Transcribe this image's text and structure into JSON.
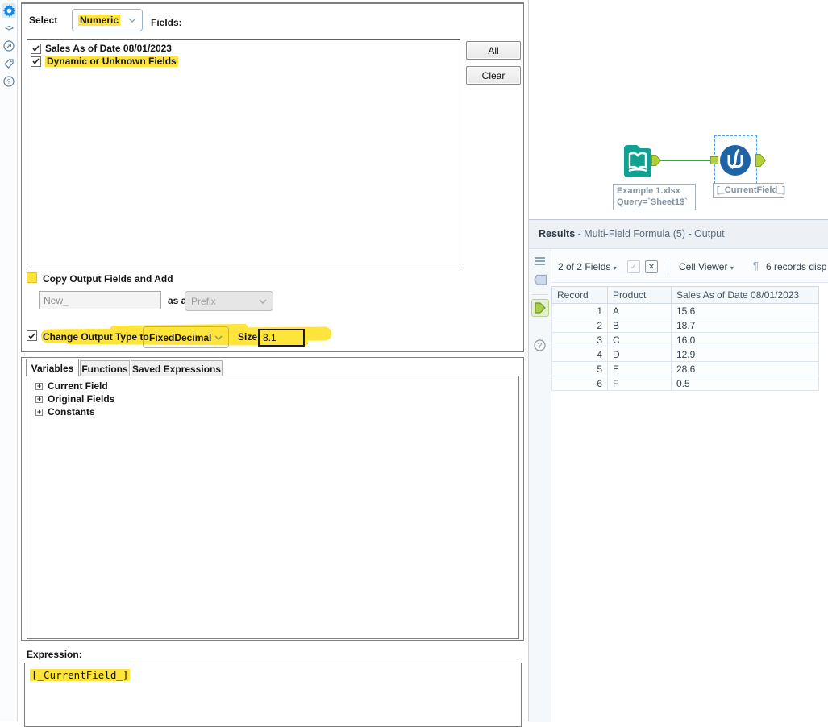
{
  "app_sidebar": {
    "icons": [
      {
        "name": "configuration-gear",
        "selected": true
      },
      {
        "name": "code",
        "selected": false
      },
      {
        "name": "open-external",
        "selected": false
      },
      {
        "name": "tag",
        "selected": false
      },
      {
        "name": "help",
        "selected": false
      }
    ]
  },
  "config": {
    "select_label": "Select",
    "field_type_value": "Numeric",
    "fields_label": "Fields:",
    "field_list": {
      "items": [
        {
          "label": "Sales As of Date 08/01/2023",
          "checked": true,
          "highlighted": false
        },
        {
          "label": "Dynamic or Unknown Fields",
          "checked": true,
          "highlighted": true
        }
      ]
    },
    "buttons": {
      "all": "All",
      "clear": "Clear"
    },
    "copy_output": {
      "label": "Copy Output Fields and Add",
      "checked": false,
      "highlighted_checkbox": true
    },
    "new_field_value": "New_",
    "as_a_label": "as a",
    "prefix_value": "Prefix",
    "change_type": {
      "label": "Change Output Type to",
      "checked": true
    },
    "output_type_value": "FixedDecimal",
    "size_label": "Size:",
    "size_value": "8.1",
    "tabs": [
      {
        "label": "Variables",
        "active": true
      },
      {
        "label": "Functions",
        "active": false
      },
      {
        "label": "Saved Expressions",
        "active": false
      }
    ],
    "tree": [
      {
        "label": "Current Field"
      },
      {
        "label": "Original Fields"
      },
      {
        "label": "Constants"
      }
    ],
    "expression_label": "Expression:",
    "expression_value": "[_CurrentField_]"
  },
  "canvas": {
    "input_tool": {
      "name": "Input Data",
      "annotation_line1": "Example 1.xlsx",
      "annotation_line2": "Query=`Sheet1$`"
    },
    "formula_tool": {
      "name": "Multi-Field Formula",
      "annotation": "[_CurrentField_]",
      "selected": true
    }
  },
  "results": {
    "title_bold": "Results",
    "title_rest": " - Multi-Field Formula (5) - Output",
    "fields_summary": "2 of 2 Fields",
    "cell_viewer_label": "Cell Viewer",
    "records_text": "6 records disp",
    "table": {
      "columns": [
        "Record",
        "Product",
        "Sales As of Date 08/01/2023"
      ],
      "rows": [
        [
          "1",
          "A",
          "15.6"
        ],
        [
          "2",
          "B",
          "18.7"
        ],
        [
          "3",
          "C",
          "16.0"
        ],
        [
          "4",
          "D",
          "12.9"
        ],
        [
          "5",
          "E",
          "28.6"
        ],
        [
          "6",
          "F",
          "0.5"
        ]
      ]
    }
  },
  "colors": {
    "highlight_yellow": "#ffe43c",
    "tool_blue": "#1e63a6",
    "tool_teal": "#10a191",
    "anchor_green": "#b2d237",
    "connection_green": "#3aa23c",
    "selection_blue": "#3da4ff",
    "accent_blue": "#1a85dd"
  }
}
